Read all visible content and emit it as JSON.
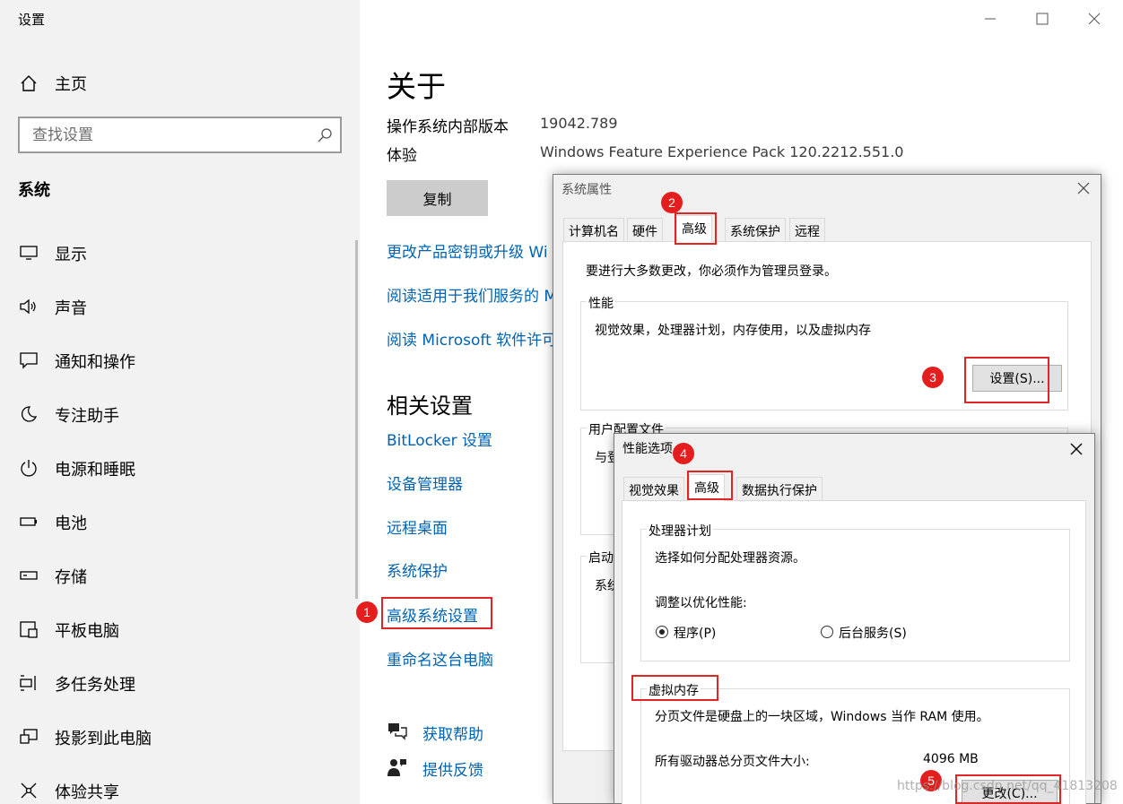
{
  "app": {
    "title": "设置"
  },
  "sidebar": {
    "home_label": "主页",
    "search_placeholder": "查找设置",
    "section_heading": "系统",
    "items": [
      {
        "label": "显示",
        "icon": "monitor-icon"
      },
      {
        "label": "声音",
        "icon": "speaker-icon"
      },
      {
        "label": "通知和操作",
        "icon": "notification-icon"
      },
      {
        "label": "专注助手",
        "icon": "moon-icon"
      },
      {
        "label": "电源和睡眠",
        "icon": "power-icon"
      },
      {
        "label": "电池",
        "icon": "battery-icon"
      },
      {
        "label": "存储",
        "icon": "storage-icon"
      },
      {
        "label": "平板电脑",
        "icon": "tablet-icon"
      },
      {
        "label": "多任务处理",
        "icon": "multitask-icon"
      },
      {
        "label": "投影到此电脑",
        "icon": "project-icon"
      },
      {
        "label": "体验共享",
        "icon": "share-icon"
      }
    ]
  },
  "main": {
    "title": "关于",
    "os_build_label": "操作系统内部版本",
    "os_build_value": "19042.789",
    "experience_label": "体验",
    "experience_value": "Windows Feature Experience Pack 120.2212.551.0",
    "copy_button": "复制",
    "links": [
      "更改产品密钥或升级 Wi",
      "阅读适用于我们服务的 M",
      "阅读 Microsoft 软件许可"
    ],
    "related_heading": "相关设置",
    "related_links": [
      "BitLocker 设置",
      "设备管理器",
      "远程桌面",
      "系统保护",
      "高级系统设置",
      "重命名这台电脑"
    ],
    "help_label": "获取帮助",
    "feedback_label": "提供反馈"
  },
  "sysprops": {
    "title": "系统属性",
    "tabs": [
      "计算机名",
      "硬件",
      "高级",
      "系统保护",
      "远程"
    ],
    "admin_note": "要进行大多数更改，你必须作为管理员登录。",
    "perf_group": "性能",
    "perf_desc": "视觉效果，处理器计划，内存使用，以及虚拟内存",
    "settings_button": "设置(S)...",
    "profile_group": "用户配置文件",
    "profile_partial": "与登",
    "startup_group": "启动",
    "startup_partial": "系统"
  },
  "perfopts": {
    "title": "性能选项",
    "tabs": [
      "视觉效果",
      "高级",
      "数据执行保护"
    ],
    "cpu_group": "处理器计划",
    "cpu_desc": "选择如何分配处理器资源。",
    "adjust_label": "调整以优化性能:",
    "radio_programs": "程序(P)",
    "radio_background": "后台服务(S)",
    "vm_group": "虚拟内存",
    "vm_desc": "分页文件是硬盘上的一块区域，Windows 当作 RAM 使用。",
    "vm_total_label": "所有驱动器总分页文件大小:",
    "vm_total_value": "4096 MB",
    "change_button": "更改(C)..."
  },
  "annotations": {
    "badges": [
      "1",
      "2",
      "3",
      "4",
      "5"
    ],
    "color": "#e12424"
  },
  "watermark": "https://blog.csdn.net/qq_41813208"
}
